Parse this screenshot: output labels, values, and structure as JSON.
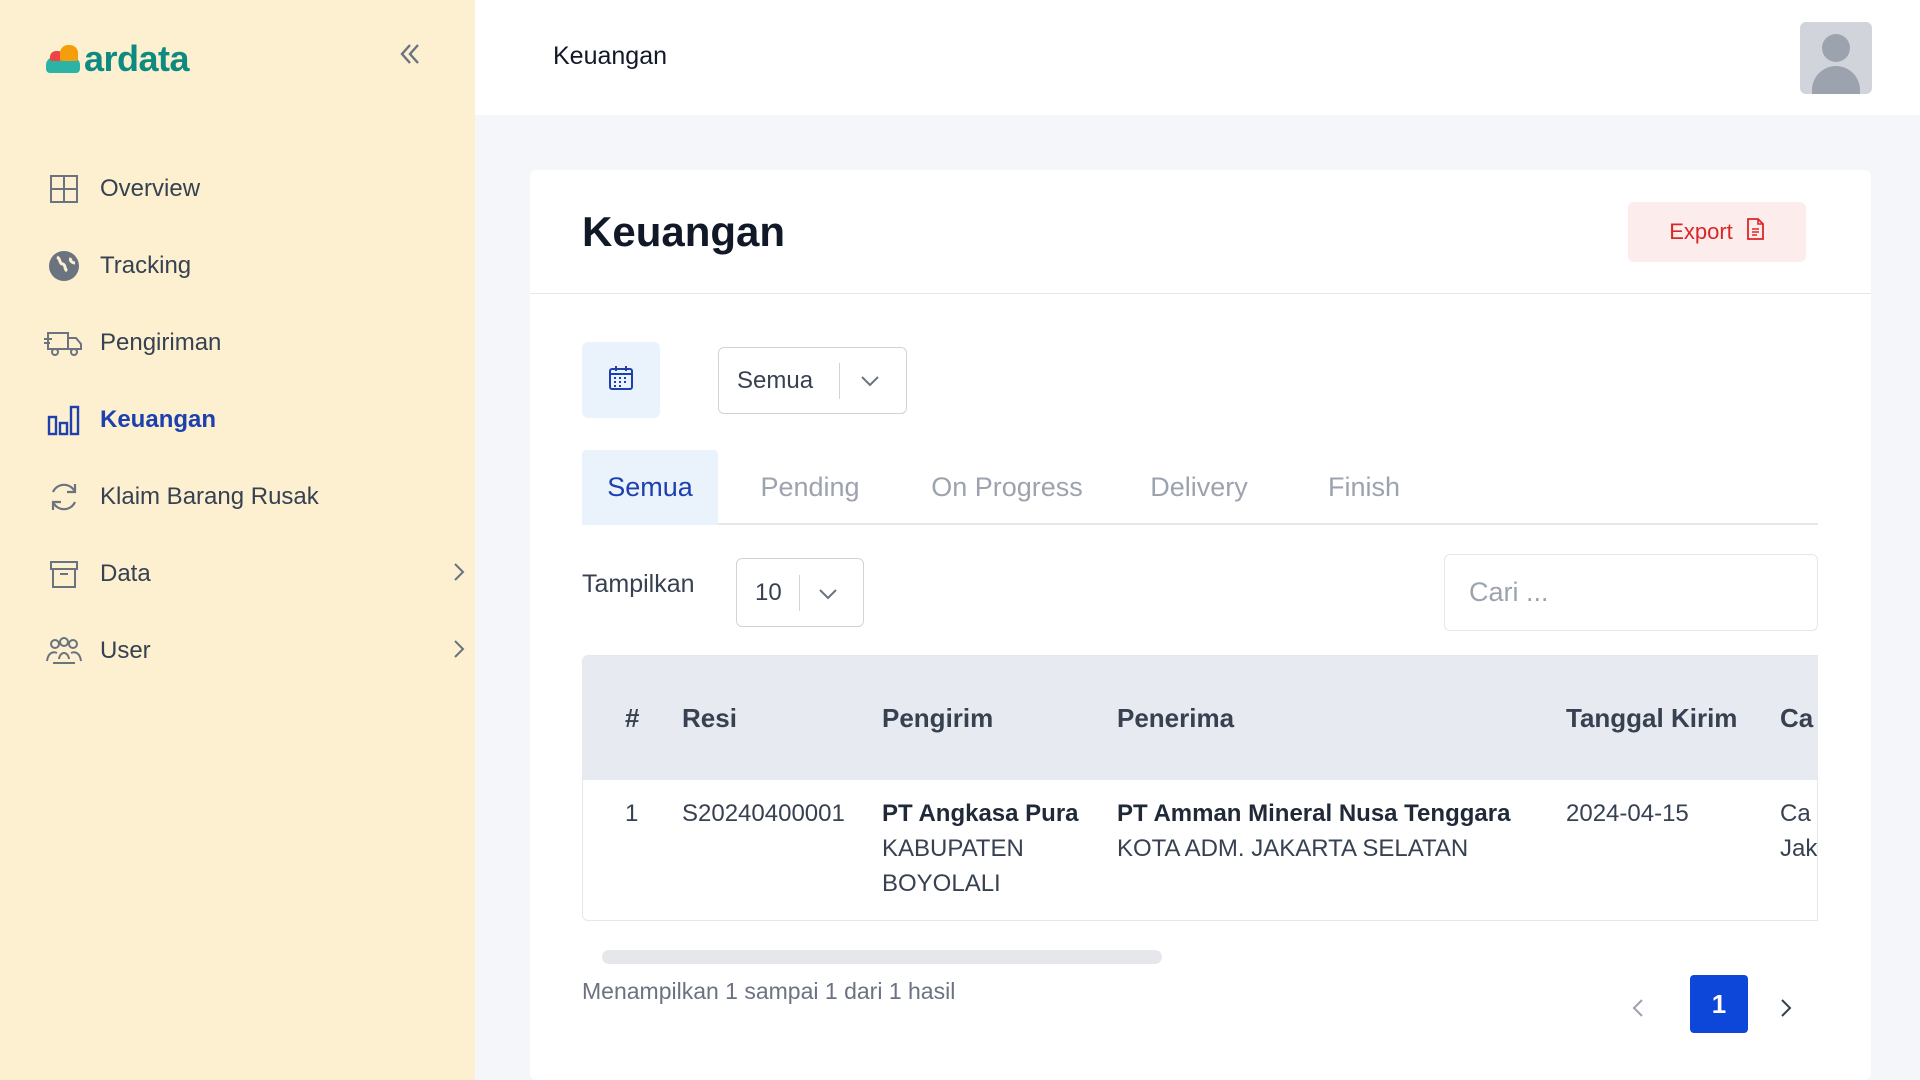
{
  "brand": {
    "name": "ardata"
  },
  "sidebar": {
    "items": [
      {
        "label": "Overview",
        "icon": "grid-icon"
      },
      {
        "label": "Tracking",
        "icon": "globe-icon"
      },
      {
        "label": "Pengiriman",
        "icon": "truck-icon"
      },
      {
        "label": "Keuangan",
        "icon": "bar-chart-icon",
        "active": true
      },
      {
        "label": "Klaim Barang Rusak",
        "icon": "refresh-icon"
      },
      {
        "label": "Data",
        "icon": "archive-icon",
        "has_submenu": true
      },
      {
        "label": "User",
        "icon": "users-icon",
        "has_submenu": true
      }
    ]
  },
  "header": {
    "title": "Keuangan"
  },
  "main": {
    "title": "Keuangan",
    "export_label": "Export",
    "status_filter": "Semua",
    "tabs": [
      "Semua",
      "Pending",
      "On Progress",
      "Delivery",
      "Finish"
    ],
    "active_tab": "Semua",
    "show_label": "Tampilkan",
    "page_length": "10",
    "search_placeholder": "Cari ..."
  },
  "table": {
    "columns": [
      "#",
      "Resi",
      "Pengirim",
      "Penerima",
      "Tanggal Kirim",
      "Ca"
    ],
    "rows": [
      {
        "no": "1",
        "resi": "S20240400001",
        "pengirim_name": "PT Angkasa Pura",
        "pengirim_city_1": "KABUPATEN",
        "pengirim_city_2": "BOYOLALI",
        "penerima_name": "PT Amman Mineral Nusa Tenggara",
        "penerima_city": "KOTA ADM. JAKARTA SELATAN",
        "tanggal": "2024-04-15",
        "cabang_1": "Ca",
        "cabang_2": "Jak"
      }
    ]
  },
  "pagination": {
    "info": "Menampilkan 1 sampai 1 dari 1 hasil",
    "current_page": "1"
  },
  "colors": {
    "sidebar_bg": "#fcf0d1",
    "accent": "#1e40af",
    "page_button": "#0d47d9",
    "export": "#dc2626"
  }
}
